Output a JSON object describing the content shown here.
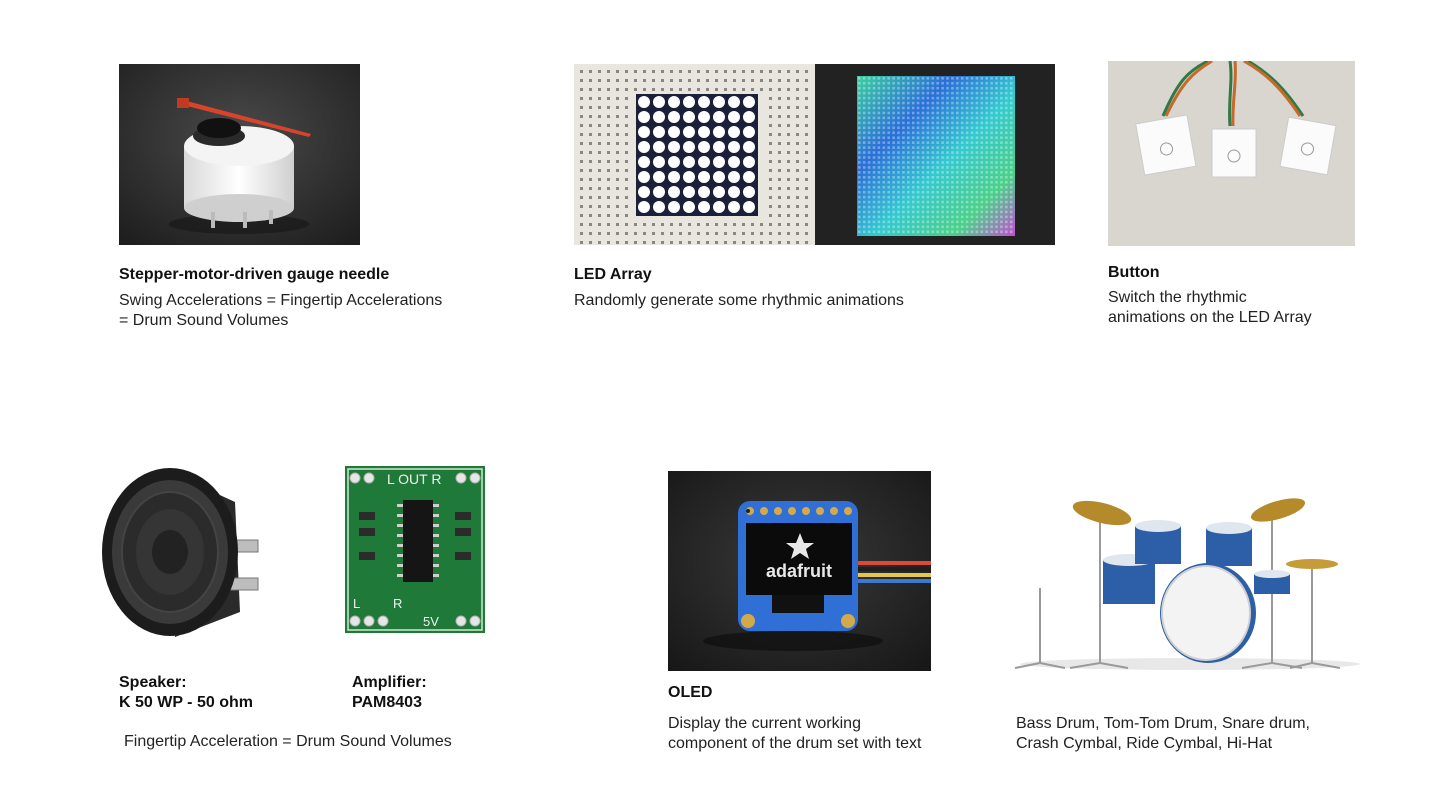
{
  "components": {
    "gauge": {
      "title": "Stepper-motor-driven gauge needle",
      "line1": "Swing Accelerations = Fingertip Accelerations",
      "line2": "= Drum Sound Volumes",
      "image_icon": "gauge-needle-photo"
    },
    "led": {
      "title": "LED Array",
      "line1": "Randomly generate some rhythmic animations",
      "image_icon": "led-matrix-photo"
    },
    "button": {
      "title": "Button",
      "line1": "Switch the rhythmic",
      "line2": "animations on the LED Array",
      "image_icon": "touch-button-photo"
    },
    "speaker": {
      "title_line1": "Speaker:",
      "title_line2": "K 50 WP - 50 ohm",
      "image_icon": "speaker-photo"
    },
    "amplifier": {
      "title_line1": "Amplifier:",
      "title_line2": "PAM8403",
      "board_top_label": "L OUT R",
      "board_bottom_left": "L",
      "board_bottom_right": "R",
      "board_voltage": "5V",
      "image_icon": "amplifier-board-photo"
    },
    "audio_note": "Fingertip Acceleration = Drum Sound Volumes",
    "oled": {
      "title": "OLED",
      "line1": "Display the current working",
      "line2": "component of the drum set with text",
      "screen_text": "adafruit",
      "image_icon": "oled-module-photo"
    },
    "drums": {
      "line1": "Bass Drum, Tom-Tom Drum, Snare drum,",
      "line2": "Crash Cymbal, Ride Cymbal, Hi-Hat",
      "image_icon": "drum-set-photo"
    }
  },
  "colors": {
    "text": "#1a1a1a",
    "background": "#ffffff",
    "pcb_green": "#1f7a3a",
    "oled_blue": "#2f6fd6",
    "drum_blue": "#2d5fa8"
  }
}
